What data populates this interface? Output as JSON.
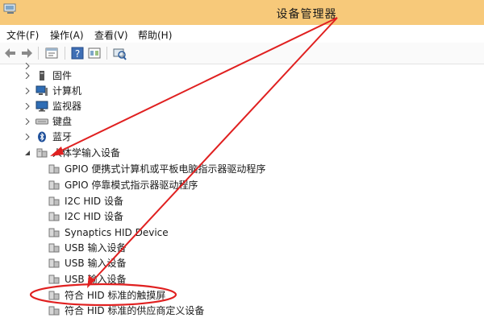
{
  "window": {
    "title": "设备管理器",
    "titlebar_color": "#f7c97a",
    "app_icon": "device-manager-icon"
  },
  "menu": {
    "items": [
      {
        "label": "文件(F)"
      },
      {
        "label": "操作(A)"
      },
      {
        "label": "查看(V)"
      },
      {
        "label": "帮助(H)"
      }
    ]
  },
  "toolbar": {
    "buttons": [
      {
        "icon": "back-arrow-icon"
      },
      {
        "icon": "forward-arrow-icon"
      },
      {
        "icon": "properties-icon"
      },
      {
        "icon": "help-icon"
      },
      {
        "icon": "view-icon"
      },
      {
        "icon": "scan-hardware-icon"
      }
    ]
  },
  "tree": {
    "categories": [
      {
        "label": "固件",
        "icon": "firmware-icon"
      },
      {
        "label": "计算机",
        "icon": "computer-icon"
      },
      {
        "label": "监视器",
        "icon": "monitor-icon"
      },
      {
        "label": "键盘",
        "icon": "keyboard-icon"
      },
      {
        "label": "蓝牙",
        "icon": "bluetooth-icon"
      }
    ],
    "expanded_category": {
      "label": "人体学输入设备",
      "icon": "hid-device-icon",
      "children": [
        {
          "label": "GPIO 便携式计算机或平板电脑指示器驱动程序"
        },
        {
          "label": "GPIO 停靠模式指示器驱动程序"
        },
        {
          "label": "I2C HID 设备"
        },
        {
          "label": "I2C HID 设备"
        },
        {
          "label": "Synaptics HID Device"
        },
        {
          "label": "USB 输入设备"
        },
        {
          "label": "USB 输入设备"
        },
        {
          "label": "USB 输入设备"
        },
        {
          "label": "符合 HID 标准的触摸屏"
        },
        {
          "label": "符合 HID 标准的供应商定义设备"
        }
      ]
    }
  },
  "annotation": {
    "color": "#e02020",
    "highlighted_item": "符合 HID 标准的触摸屏"
  }
}
